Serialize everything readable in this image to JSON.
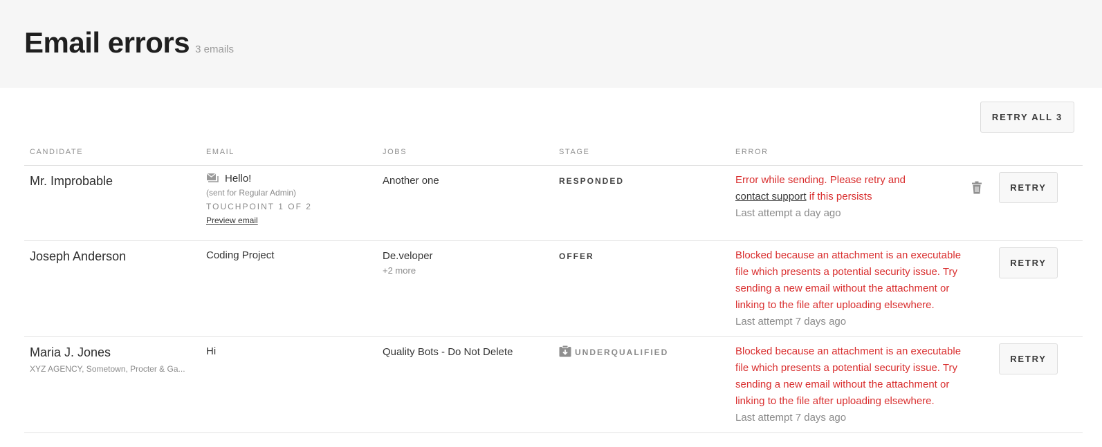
{
  "header": {
    "title": "Email errors",
    "count": "3 emails"
  },
  "toolbar": {
    "retry_all_label": "RETRY ALL 3"
  },
  "table": {
    "columns": {
      "candidate": "CANDIDATE",
      "email": "EMAIL",
      "jobs": "JOBS",
      "stage": "STAGE",
      "error": "ERROR"
    },
    "retry_label": "RETRY",
    "rows": [
      {
        "candidate": "Mr. Improbable",
        "email_icon": "envelope-icon",
        "email_subject": "Hello!",
        "email_note": "(sent for Regular Admin)",
        "touchpoint": "TOUCHPOINT 1 OF 2",
        "preview_label": "Preview email",
        "job": "Another one",
        "stage": "RESPONDED",
        "error_text": "Error while sending. Please retry and",
        "error_link": "contact support",
        "error_suffix": " if this persists",
        "attempt": "Last attempt a day ago",
        "delete_icon": "trash-icon"
      },
      {
        "candidate": "Joseph Anderson",
        "email_subject": "Coding Project",
        "job": "De.veloper",
        "job_more": "+2 more",
        "stage": "OFFER",
        "error_text": "Blocked because an attachment is an executable file which presents a potential security issue. Try sending a new email without the attachment or linking to the file after uploading elsewhere.",
        "attempt": "Last attempt 7 days ago"
      },
      {
        "candidate": "Maria J. Jones",
        "candidate_sub": "XYZ AGENCY, Sometown, Procter & Ga...",
        "email_subject": "Hi",
        "job": "Quality Bots - Do Not Delete",
        "stage_icon": "archive-icon",
        "stage": "UNDERQUALIFIED",
        "error_text": "Blocked because an attachment is an executable file which presents a potential security issue. Try sending a new email without the attachment or linking to the file after uploading elsewhere.",
        "attempt": "Last attempt 7 days ago"
      }
    ]
  },
  "colors": {
    "error": "#d92e2e",
    "header_bg": "#f6f6f6",
    "muted": "#8a8a8a"
  }
}
